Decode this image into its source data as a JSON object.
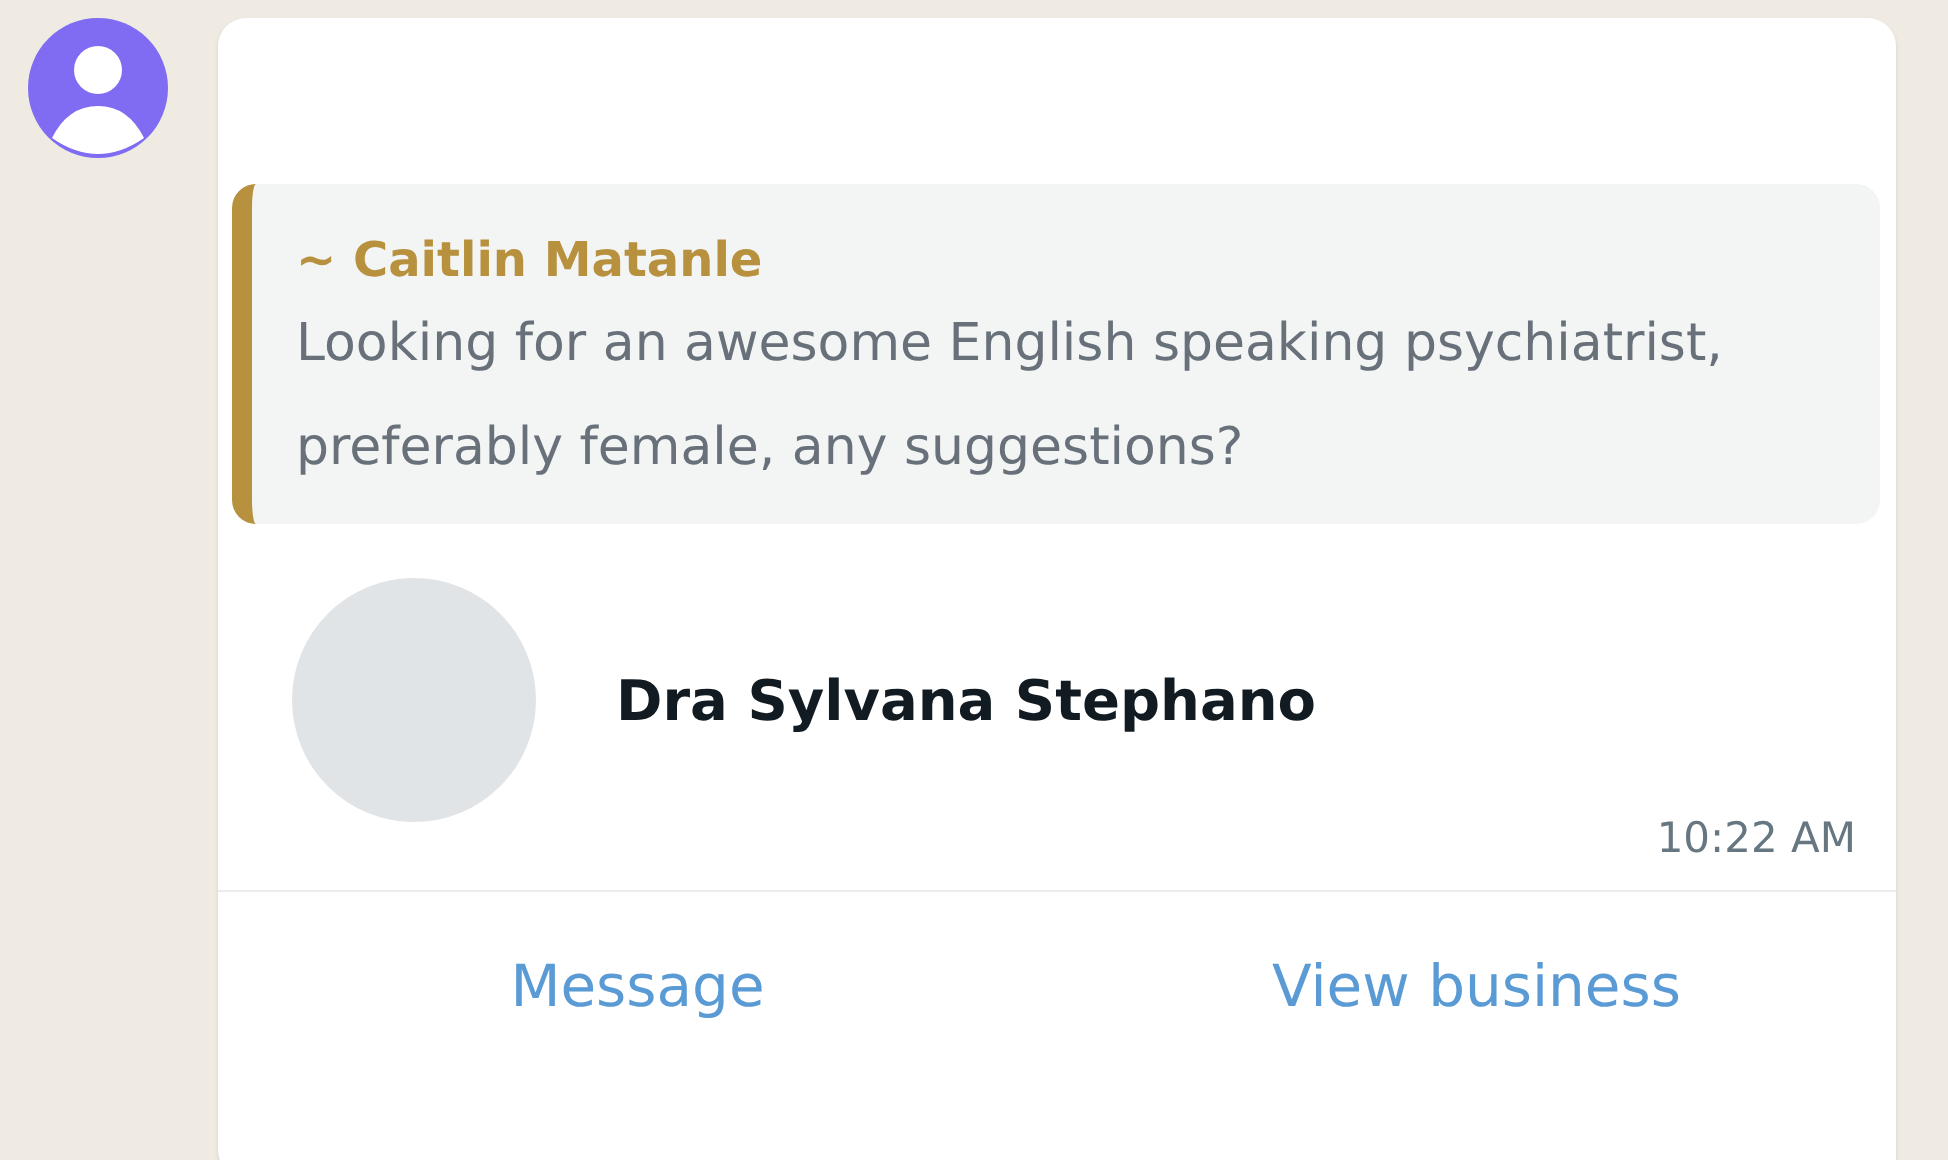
{
  "quote": {
    "author": "~ Caitlin Matanle",
    "text": "Looking for an awesome English speaking psychiatrist, preferably female, any suggestions?"
  },
  "contact": {
    "name": "Dra Sylvana Stephano"
  },
  "time": "10:22 AM",
  "actions": [
    {
      "label": "Message"
    },
    {
      "label": "View business"
    }
  ]
}
